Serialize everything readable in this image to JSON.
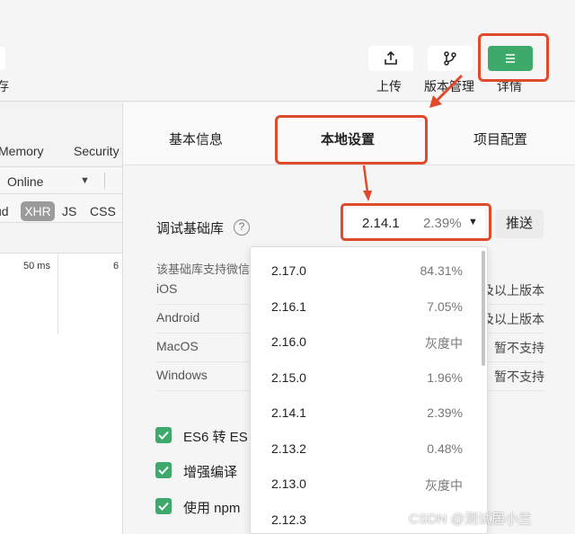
{
  "toolbar": {
    "left_label": "存",
    "upload_label": "上传",
    "version_label": "版本管理",
    "details_label": "详情"
  },
  "devtools": {
    "tabs": [
      "Memory",
      "Security"
    ],
    "throttle": "Online",
    "filters": [
      "ud",
      "XHR",
      "JS",
      "CSS"
    ],
    "timing": [
      "50 ms",
      "6"
    ]
  },
  "panel": {
    "tabs": [
      "基本信息",
      "本地设置",
      "项目配置"
    ],
    "sdk": {
      "label": "调试基础库",
      "help_icon": "question-mark",
      "selected_version": "2.14.1",
      "selected_percent": "2.39%",
      "push_label": "推送"
    },
    "info_note": "该基础库支持微信",
    "platforms": [
      {
        "name": "iOS",
        "value": "及以上版本"
      },
      {
        "name": "Android",
        "value": "及以上版本"
      },
      {
        "name": "MacOS",
        "value": "暂不支持"
      },
      {
        "name": "Windows",
        "value": "暂不支持"
      }
    ],
    "checkboxes": [
      {
        "label": "ES6 转 ES",
        "checked": true
      },
      {
        "label": "增强编译",
        "checked": true
      },
      {
        "label": "使用 npm",
        "checked": true
      }
    ]
  },
  "dropdown": {
    "options": [
      {
        "version": "2.17.0",
        "percent": "84.31%"
      },
      {
        "version": "2.16.1",
        "percent": "7.05%"
      },
      {
        "version": "2.16.0",
        "percent": "灰度中"
      },
      {
        "version": "2.15.0",
        "percent": "1.96%"
      },
      {
        "version": "2.14.1",
        "percent": "2.39%"
      },
      {
        "version": "2.13.2",
        "percent": "0.48%"
      },
      {
        "version": "2.13.0",
        "percent": "灰度中"
      },
      {
        "version": "2.12.3",
        "percent": ""
      }
    ]
  },
  "watermark": "CSDN @测试居小兰",
  "colors": {
    "accent_green": "#3daa6b",
    "annotation_red": "#e04a2c"
  }
}
